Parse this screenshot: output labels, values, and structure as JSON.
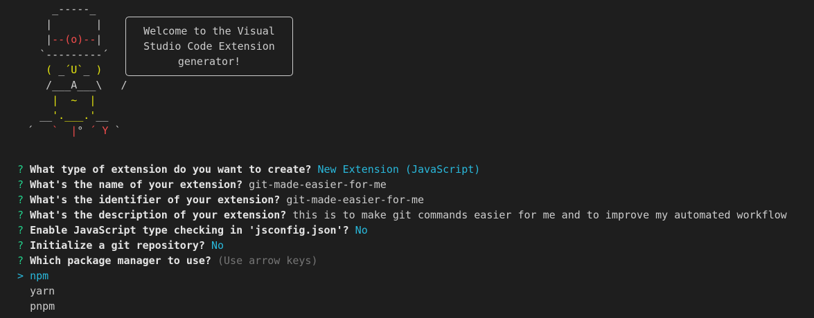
{
  "ascii_art": {
    "lines": [
      [
        {
          "t": "     _-----_",
          "c": ""
        }
      ],
      [
        {
          "t": "    |       |",
          "c": ""
        }
      ],
      [
        {
          "t": "    |",
          "c": ""
        },
        {
          "t": "--(o)--",
          "c": "red"
        },
        {
          "t": "|",
          "c": ""
        }
      ],
      [
        {
          "t": "   `---------´",
          "c": ""
        }
      ],
      [
        {
          "t": "    ",
          "c": ""
        },
        {
          "t": "( ",
          "c": "yellow"
        },
        {
          "t": "_",
          "c": ""
        },
        {
          "t": "´U`",
          "c": "yellow"
        },
        {
          "t": "_",
          "c": ""
        },
        {
          "t": " )",
          "c": "yellow"
        }
      ],
      [
        {
          "t": "    /___A___\\   /",
          "c": ""
        }
      ],
      [
        {
          "t": "     ",
          "c": ""
        },
        {
          "t": "|  ~  |",
          "c": "yellow"
        }
      ],
      [
        {
          "t": "   __",
          "c": ""
        },
        {
          "t": "'.___.'",
          "c": "yellow"
        },
        {
          "t": "__",
          "c": ""
        }
      ],
      [
        {
          "t": " ´   ",
          "c": ""
        },
        {
          "t": "`  |",
          "c": "red"
        },
        {
          "t": "° ",
          "c": ""
        },
        {
          "t": "´ Y",
          "c": "red"
        },
        {
          "t": " `",
          "c": ""
        }
      ]
    ]
  },
  "speech": {
    "text": "Welcome to the Visual\nStudio Code Extension\ngenerator!"
  },
  "prompts": [
    {
      "mark": "?",
      "question": "What type of extension do you want to create?",
      "answer": "New Extension (JavaScript)",
      "style": "cyan"
    },
    {
      "mark": "?",
      "question": "What's the name of your extension?",
      "answer": "git-made-easier-for-me",
      "style": "plain"
    },
    {
      "mark": "?",
      "question": "What's the identifier of your extension?",
      "answer": "git-made-easier-for-me",
      "style": "plain"
    },
    {
      "mark": "?",
      "question": "What's the description of your extension?",
      "answer": "this is to make git commands easier for me and to improve my automated workflow",
      "style": "plain"
    },
    {
      "mark": "?",
      "question": "Enable JavaScript type checking in 'jsconfig.json'?",
      "answer": "No",
      "style": "cyan"
    },
    {
      "mark": "?",
      "question": "Initialize a git repository?",
      "answer": "No",
      "style": "cyan"
    },
    {
      "mark": "?",
      "question": "Which package manager to use?",
      "answer": "(Use arrow keys)",
      "style": "hint"
    }
  ],
  "options": {
    "pointer": ">",
    "items": [
      "npm",
      "yarn",
      "pnpm"
    ],
    "selected_index": 0
  },
  "colors": {
    "background": "#1e1e1e",
    "question_mark": "#23d18b",
    "cyan": "#29b8db",
    "red": "#f14c4c",
    "yellow": "#e5e510",
    "hint": "#767676"
  }
}
